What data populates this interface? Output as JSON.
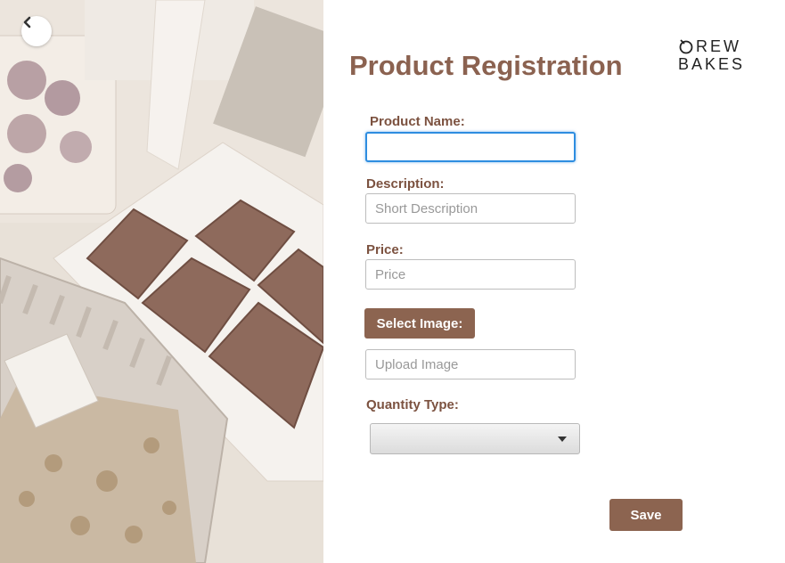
{
  "form": {
    "title": "Product Registration",
    "product_name": {
      "label": "Product Name:",
      "value": ""
    },
    "description": {
      "label": "Description:",
      "placeholder": "Short Description"
    },
    "price": {
      "label": "Price:",
      "placeholder": "Price"
    },
    "select_image_label": "Select Image:",
    "upload": {
      "placeholder": "Upload Image"
    },
    "quantity_type": {
      "label": "Quantity Type:",
      "selected": ""
    },
    "save_label": "Save"
  },
  "logo": {
    "line1": "REW",
    "line2": "BAKES"
  },
  "colors": {
    "brand_brown": "#8c6450",
    "title_brown": "#8b6250",
    "focus_blue": "#2e8de0"
  },
  "icons": {
    "back": "chevron-left-icon",
    "dropdown": "caret-down-icon"
  }
}
